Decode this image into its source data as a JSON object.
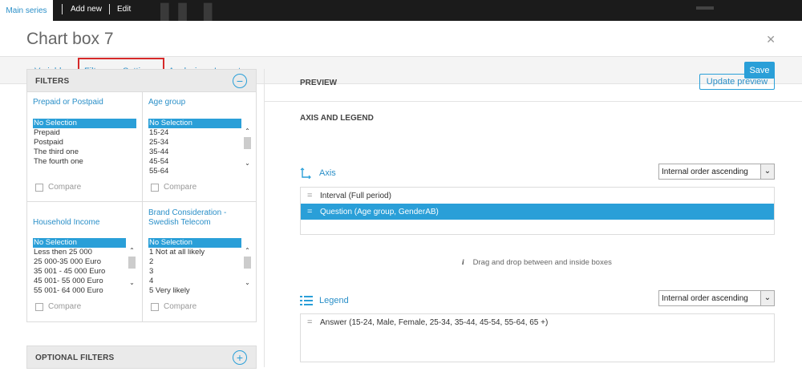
{
  "topbar": {
    "main_series": "Main series",
    "add_new": "Add new",
    "edit": "Edit"
  },
  "modal": {
    "title": "Chart box 7",
    "close_icon": "close-icon",
    "save_label": "Save"
  },
  "tabs": [
    {
      "label": "Variables"
    },
    {
      "label": "Filters"
    },
    {
      "label": "Settings"
    },
    {
      "label": "Analysis"
    },
    {
      "label": "Layout"
    }
  ],
  "filters": {
    "heading": "FILTERS",
    "collapse_icon": "minus-circle-icon",
    "compare_label": "Compare",
    "cells": [
      {
        "title": "Prepaid or Postpaid",
        "options": [
          "No Selection",
          "Prepaid",
          "Postpaid",
          "The third one",
          "The fourth one"
        ]
      },
      {
        "title": "Age group",
        "options": [
          "No Selection",
          "15-24",
          "25-34",
          "35-44",
          "45-54",
          "55-64"
        ]
      },
      {
        "title": "Household Income",
        "options": [
          "No Selection",
          "Less then 25 000",
          "25 000-35 000 Euro",
          "35 001 - 45 000 Euro",
          "45 001- 55 000 Euro",
          "55 001- 64 000 Euro"
        ]
      },
      {
        "title": "Brand Consideration - Swedish Telecom",
        "options": [
          "No Selection",
          "1 Not at all likely",
          "2",
          "3",
          "4",
          "5 Very likely"
        ]
      }
    ],
    "selected_value": "No Selection"
  },
  "optional_filters": {
    "heading": "OPTIONAL FILTERS",
    "add_icon": "plus-circle-icon"
  },
  "preview": {
    "heading": "PREVIEW",
    "update_label": "Update preview",
    "section": "AXIS AND LEGEND",
    "axis": {
      "label": "Axis",
      "icon": "axis-icon",
      "order": "Internal order ascending",
      "rows": [
        "Interval (Full period)",
        "Question (Age group, GenderAB)"
      ],
      "active_row": "Question (Age group, GenderAB)"
    },
    "hint": "Drag and drop between and inside boxes",
    "legend": {
      "label": "Legend",
      "icon": "list-icon",
      "order": "Internal order ascending",
      "rows": [
        "Answer (15-24, Male, Female, 25-34, 35-44, 45-54, 55-64, 65 +)"
      ]
    }
  },
  "colors": {
    "accent": "#2a9fd8",
    "highlight_border": "#d62a2a"
  }
}
